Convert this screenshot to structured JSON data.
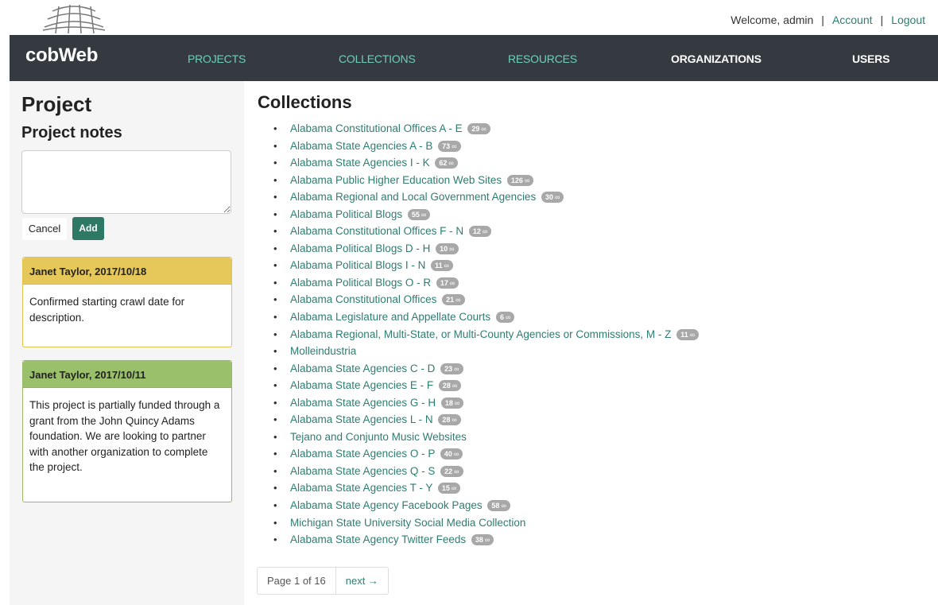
{
  "header": {
    "welcome": "Welcome, admin",
    "separator": "|",
    "account": "Account",
    "logout": "Logout"
  },
  "nav": {
    "brand": "cobWeb",
    "items": [
      "PROJECTS",
      "COLLECTIONS",
      "RESOURCES",
      "ORGANIZATIONS",
      "USERS"
    ]
  },
  "sidebar": {
    "title": "Project",
    "subtitle": "Project notes",
    "cancel": "Cancel",
    "add": "Add",
    "notes": [
      {
        "author": "Janet Taylor, 2017/10/18",
        "text": "Confirmed starting crawl date for description."
      },
      {
        "author": "Janet Taylor, 2017/10/11",
        "text": "This project is partially funded through a grant from the John Quincy Adams foundation. We are looking to partner with another organization to complete the project."
      }
    ]
  },
  "main": {
    "title": "Collections",
    "collections": [
      {
        "name": "Alabama Constitutional Offices A - E",
        "count": "29"
      },
      {
        "name": "Alabama State Agencies A - B",
        "count": "73"
      },
      {
        "name": "Alabama State Agencies I - K",
        "count": "62"
      },
      {
        "name": "Alabama Public Higher Education Web Sites",
        "count": "126"
      },
      {
        "name": "Alabama Regional and Local Government Agencies",
        "count": "30"
      },
      {
        "name": "Alabama Political Blogs",
        "count": "55"
      },
      {
        "name": "Alabama Constitutional Offices F - N",
        "count": "12"
      },
      {
        "name": "Alabama Political Blogs D - H",
        "count": "10"
      },
      {
        "name": "Alabama Political Blogs I - N",
        "count": "11"
      },
      {
        "name": "Alabama Political Blogs O - R",
        "count": "17"
      },
      {
        "name": "Alabama Constitutional Offices",
        "count": "21"
      },
      {
        "name": "Alabama Legislature and Appellate Courts",
        "count": "6"
      },
      {
        "name": "Alabama Regional, Multi-State, or Multi-County Agencies or Commissions, M - Z",
        "count": "11"
      },
      {
        "name": "Molleindustria",
        "count": ""
      },
      {
        "name": "Alabama State Agencies C - D",
        "count": "23"
      },
      {
        "name": "Alabama State Agencies E - F",
        "count": "28"
      },
      {
        "name": "Alabama State Agencies G - H",
        "count": "18"
      },
      {
        "name": "Alabama State Agencies L - N",
        "count": "28"
      },
      {
        "name": "Tejano and Conjunto Music Websites",
        "count": ""
      },
      {
        "name": "Alabama State Agencies O - P",
        "count": "40"
      },
      {
        "name": "Alabama State Agencies Q - S",
        "count": "22"
      },
      {
        "name": "Alabama State Agencies T - Y",
        "count": "15"
      },
      {
        "name": "Alabama State Agency Facebook Pages",
        "count": "58"
      },
      {
        "name": "Michigan State University Social Media Collection",
        "count": ""
      },
      {
        "name": "Alabama State Agency Twitter Feeds",
        "count": "38"
      }
    ],
    "pager": {
      "current": "Page 1 of 16",
      "next": "next →"
    }
  },
  "icons": {
    "logo": "web-logo-icon",
    "link": "link-icon"
  },
  "colors": {
    "nav_bg": "#343a40",
    "accent": "#2e7d71",
    "nav_teal": "#6fcfb7",
    "note_yellow": "#e6c85a",
    "note_green": "#9bc06b"
  }
}
